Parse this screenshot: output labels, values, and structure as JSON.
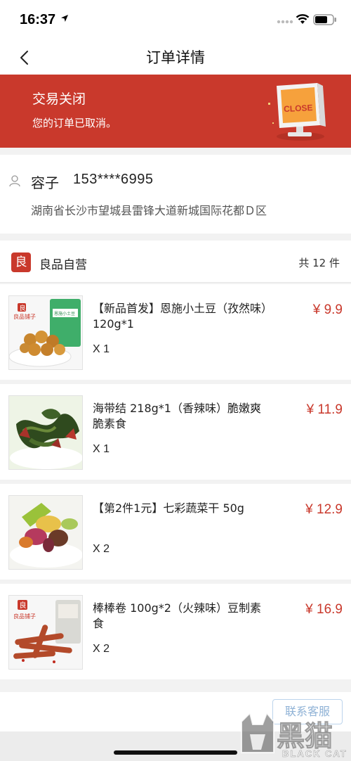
{
  "status_bar": {
    "time": "16:37"
  },
  "nav": {
    "title": "订单详情"
  },
  "banner": {
    "title": "交易关闭",
    "subtitle": "您的订单已取消。",
    "close_sign": "CLOSE"
  },
  "address": {
    "name": "容子",
    "phone": "153****6995",
    "address_line": "湖南省长沙市望城县雷锋大道新城国际花都Ｄ区"
  },
  "store": {
    "logo_char": "良",
    "name": "良品自营",
    "item_count": "共 12 件"
  },
  "items": [
    {
      "name": "【新品首发】恩施小土豆（孜然味）120g*1",
      "qty": "X 1",
      "price": "¥ 9.9",
      "thumb_logo": "良",
      "thumb_text": "良品铺子",
      "pack_text": "恩施小土豆"
    },
    {
      "name": "海带结 218g*1（香辣味）脆嫩爽脆素食",
      "qty": "X 1",
      "price": "¥ 11.9"
    },
    {
      "name": "【第2件1元】七彩蔬菜干 50g",
      "qty": "X 2",
      "price": "¥ 12.9"
    },
    {
      "name": "棒棒卷 100g*2（火辣味）豆制素食",
      "qty": "X 2",
      "price": "¥ 16.9",
      "thumb_logo": "良",
      "thumb_text": "良品铺子"
    }
  ],
  "footer": {
    "contact_button": "联系客服"
  },
  "watermark": {
    "cn": "黑猫",
    "en": "BLACK CAT"
  },
  "colors": {
    "accent": "#c9392c",
    "link": "#8fb2d6"
  }
}
